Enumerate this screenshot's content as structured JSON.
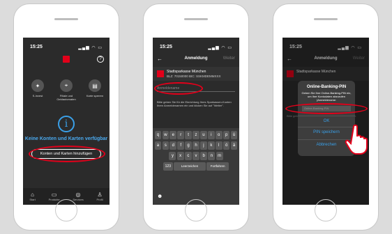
{
  "phone1": {
    "time": "15:25",
    "tiles": [
      {
        "label": "S-Invest",
        "icon": "invest-icon"
      },
      {
        "label": "Filiale und Geldautomaten",
        "icon": "location-icon"
      },
      {
        "label": "Karte sperren",
        "icon": "card-lock-icon"
      }
    ],
    "title": "Keine Konten und Karten verfügbar",
    "button": "Konten und Karten hinzufügen",
    "tabs": [
      {
        "label": "Start",
        "icon": "home-icon"
      },
      {
        "label": "Produkte",
        "icon": "products-icon"
      },
      {
        "label": "Services",
        "icon": "services-icon"
      },
      {
        "label": "Profil",
        "icon": "profile-icon"
      }
    ]
  },
  "phone2": {
    "time": "15:25",
    "nav_title": "Anmeldung",
    "nav_next": "Weiter",
    "bank_name": "Stadtsparkasse München",
    "bank_code": "BLZ: 70150000   BIC: SSKMDEMMXXX",
    "field_placeholder": "Anmeldename",
    "hint": "Bitte geben Sie für die Einrichtung Ihres Sparkassen-Konten Ihren Anmeldenamen ein und klicken Sie auf \"Weiter\".",
    "keyboard": {
      "row1": [
        "q",
        "w",
        "e",
        "r",
        "t",
        "z",
        "u",
        "i",
        "o",
        "p",
        "ü"
      ],
      "row2": [
        "a",
        "s",
        "d",
        "f",
        "g",
        "h",
        "j",
        "k",
        "l",
        "ö",
        "ä"
      ],
      "row3": [
        "y",
        "x",
        "c",
        "v",
        "b",
        "n",
        "m"
      ],
      "numbers": "123",
      "space": "Leerzeichen",
      "return": "Fortfahren"
    }
  },
  "phone3": {
    "time": "15:25",
    "nav_title": "Anmeldung",
    "nav_next": "Weiter",
    "bank_name": "Stadtsparkasse München",
    "dialog_title": "Online-Banking-PIN",
    "dialog_message": "Geben Sie Ihre Online-Banking-PIN ein, um Ihre Kontodaten abzurufen (Anmeldename:",
    "pin_placeholder": "Online-Banking-PIN",
    "ok": "OK",
    "save_pin": "PIN speichern",
    "cancel": "Abbrechen",
    "bg_text": "Bitte geben Sie für die Einrichtung Ihres Anmeldenamen"
  },
  "colors": {
    "accent": "#e2001a",
    "link": "#3aa0e8"
  }
}
